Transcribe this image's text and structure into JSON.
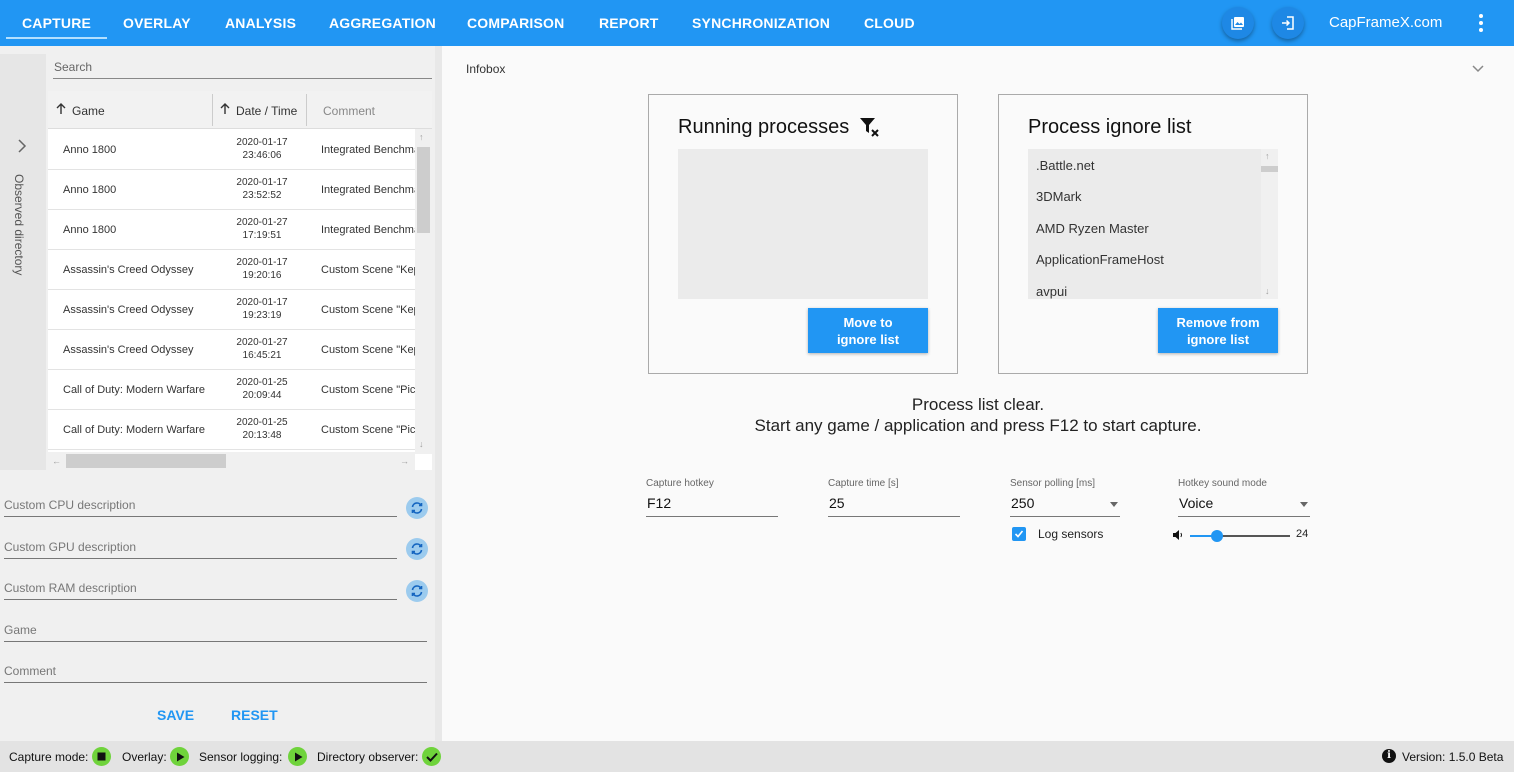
{
  "nav": {
    "tabs": [
      "CAPTURE",
      "OVERLAY",
      "ANALYSIS",
      "AGGREGATION",
      "COMPARISON",
      "REPORT",
      "SYNCHRONIZATION",
      "CLOUD"
    ],
    "active_tab": "CAPTURE",
    "site_link": "CapFrameX.com",
    "icons": [
      "gallery-icon",
      "login-icon",
      "more-vert-icon"
    ]
  },
  "observed_directory": {
    "label": "Observed directory"
  },
  "search": {
    "placeholder": "Search"
  },
  "table": {
    "columns": [
      "Game",
      "Date / Time",
      "Comment"
    ],
    "rows": [
      {
        "game": "Anno 1800",
        "date": "2020-01-17",
        "time": "23:46:06",
        "comment": "Integrated Benchmark"
      },
      {
        "game": "Anno 1800",
        "date": "2020-01-17",
        "time": "23:52:52",
        "comment": "Integrated Benchmark"
      },
      {
        "game": "Anno 1800",
        "date": "2020-01-27",
        "time": "17:19:51",
        "comment": "Integrated Benchmark"
      },
      {
        "game": "Assassin's Creed Odyssey",
        "date": "2020-01-17",
        "time": "19:20:16",
        "comment": "Custom Scene \"Kep"
      },
      {
        "game": "Assassin's Creed Odyssey",
        "date": "2020-01-17",
        "time": "19:23:19",
        "comment": "Custom Scene \"Kep"
      },
      {
        "game": "Assassin's Creed Odyssey",
        "date": "2020-01-27",
        "time": "16:45:21",
        "comment": "Custom Scene \"Kep"
      },
      {
        "game": "Call of Duty: Modern Warfare",
        "date": "2020-01-25",
        "time": "20:09:44",
        "comment": "Custom Scene \"Pic"
      },
      {
        "game": "Call of Duty: Modern Warfare",
        "date": "2020-01-25",
        "time": "20:13:48",
        "comment": "Custom Scene \"Pic"
      }
    ]
  },
  "form": {
    "cpu_placeholder": "Custom CPU description",
    "gpu_placeholder": "Custom GPU description",
    "ram_placeholder": "Custom RAM description",
    "game_placeholder": "Game",
    "comment_placeholder": "Comment",
    "save_label": "SAVE",
    "reset_label": "RESET"
  },
  "infobox": {
    "label": "Infobox"
  },
  "running_processes": {
    "title": "Running processes",
    "button_line1": "Move to",
    "button_line2": "ignore list"
  },
  "ignore_list": {
    "title": "Process ignore list",
    "items": [
      ".Battle.net",
      "3DMark",
      "AMD Ryzen Master",
      "ApplicationFrameHost",
      "avpui"
    ],
    "button_line1": "Remove from",
    "button_line2": "ignore list"
  },
  "status": {
    "line1": "Process list clear.",
    "line2": "Start any game / application and press  F12 to start capture."
  },
  "settings": {
    "capture_hotkey": {
      "label": "Capture hotkey",
      "value": "F12"
    },
    "capture_time": {
      "label": "Capture time [s]",
      "value": "25"
    },
    "sensor_polling": {
      "label": "Sensor polling [ms]",
      "value": "250"
    },
    "hotkey_sound_mode": {
      "label": "Hotkey sound mode",
      "value": "Voice"
    },
    "log_sensors": {
      "label": "Log sensors",
      "checked": true
    },
    "volume": {
      "value": "24",
      "fraction": 0.24
    }
  },
  "statusbar": {
    "capture_mode": "Capture mode:",
    "overlay": "Overlay:",
    "sensor_logging": "Sensor logging:",
    "directory_observer": "Directory observer:",
    "version": "Version:  1.5.0 Beta"
  },
  "colors": {
    "accent": "#2196f3",
    "indicator": "#6fd33b",
    "background": "#fafafa"
  }
}
